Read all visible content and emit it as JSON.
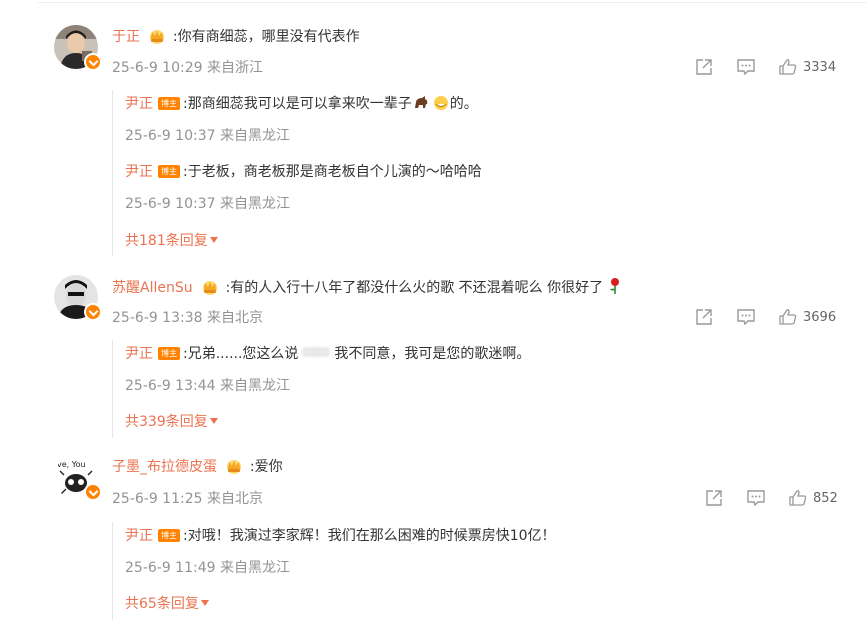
{
  "comments": [
    {
      "user": "于正",
      "text": ":你有商细蕊，哪里没有代表作",
      "meta": "25-6-9 10:29 来自浙江",
      "likes": "3334",
      "replies": [
        {
          "user": "尹正",
          "badge": "博主",
          "text": ":那商细蕊我可以是可以拿来吹一辈子",
          "text_suffix": "的。",
          "meta": "25-6-9 10:37 来自黑龙江"
        },
        {
          "user": "尹正",
          "badge": "博主",
          "text": ":于老板，商老板那是商老板自个儿演的～哈哈哈",
          "meta": "25-6-9 10:37 来自黑龙江"
        }
      ],
      "more": "共181条回复"
    },
    {
      "user": "苏醒AllenSu",
      "text": ":有的人入行十八年了都没什么火的歌 不还混着呢么 你很好了",
      "meta": "25-6-9 13:38 来自北京",
      "likes": "3696",
      "replies": [
        {
          "user": "尹正",
          "badge": "博主",
          "text": ":兄弟......您这么说",
          "text_suffix": "我不同意，我可是您的歌迷啊。",
          "meta": "25-6-9 13:44 来自黑龙江"
        }
      ],
      "more": "共339条回复"
    },
    {
      "user": "子墨_布拉德皮蛋",
      "text": ":爱你",
      "meta": "25-6-9 11:25 来自北京",
      "likes": "852",
      "replies": [
        {
          "user": "尹正",
          "badge": "博主",
          "text": ":对哦！我演过李家辉！我们在那么困难的时候票房快10亿！",
          "meta": "25-6-9 11:49 来自黑龙江"
        }
      ],
      "more": "共65条回复"
    }
  ],
  "icons": {
    "crown": "crown-icon",
    "share": "share-icon",
    "comment": "comment-icon",
    "like": "thumbs-up-icon",
    "verified": "verified-badge-icon"
  },
  "colors": {
    "username": "#eb7350",
    "badge": "#ff8200",
    "meta": "#939393",
    "text": "#333333"
  }
}
